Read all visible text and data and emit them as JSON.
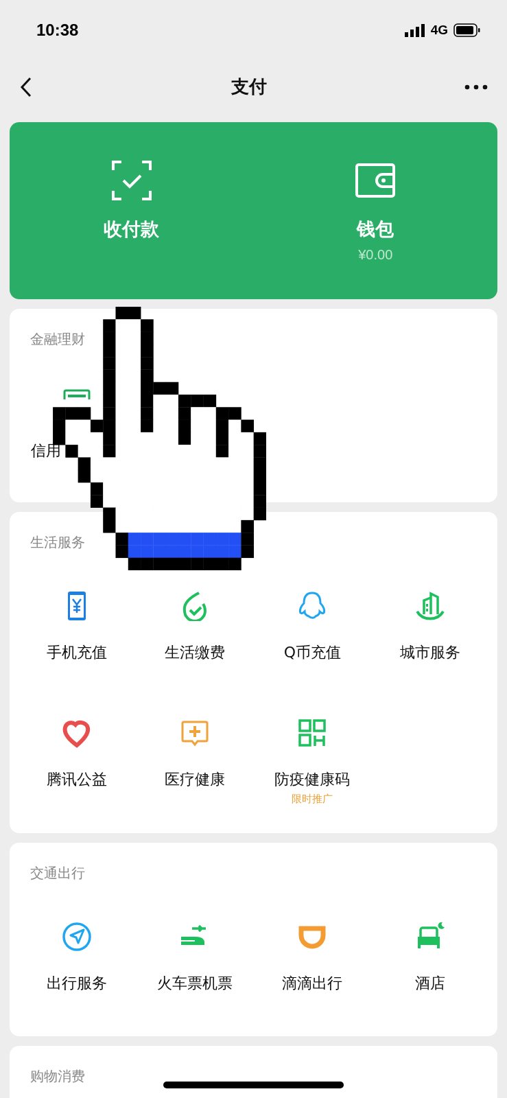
{
  "status_bar": {
    "time": "10:38",
    "network": "4G"
  },
  "nav_bar": {
    "title": "支付"
  },
  "header_card": {
    "actions": [
      {
        "label": "收付款"
      },
      {
        "label": "钱包",
        "balance": "¥0.00"
      }
    ]
  },
  "sections": [
    {
      "title": "金融理财",
      "items": [
        {
          "label": "信用",
          "kind": "partial"
        }
      ]
    },
    {
      "title": "生活服务",
      "items": [
        {
          "label": "手机充值",
          "kind": "full"
        },
        {
          "label": "生活缴费",
          "kind": "full"
        },
        {
          "label": "Q币充值",
          "kind": "full"
        },
        {
          "label": "城市服务",
          "kind": "full"
        },
        {
          "label": "腾讯公益",
          "kind": "full"
        },
        {
          "label": "医疗健康",
          "kind": "full"
        },
        {
          "label": "防疫健康码",
          "kind": "full",
          "note": "限时推广"
        }
      ]
    },
    {
      "title": "交通出行",
      "items": [
        {
          "label": "出行服务",
          "kind": "full"
        },
        {
          "label": "火车票机票",
          "kind": "full"
        },
        {
          "label": "滴滴出行",
          "kind": "full"
        },
        {
          "label": "酒店",
          "kind": "full"
        }
      ]
    },
    {
      "title": "购物消费"
    }
  ]
}
